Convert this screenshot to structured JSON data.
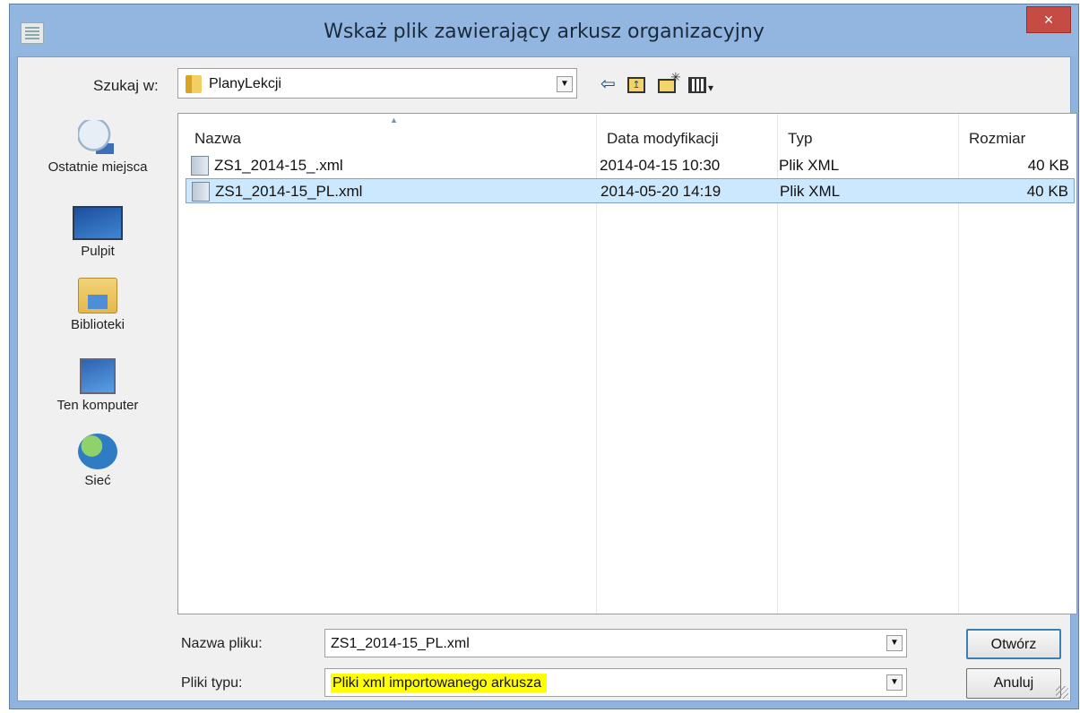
{
  "window": {
    "title": "Wskaż plik zawierający arkusz organizacyjny",
    "close_glyph": "×"
  },
  "lookin": {
    "label": "Szukaj w:",
    "value": "PlanyLekcji"
  },
  "toolbar": {
    "back_glyph": "⇦",
    "up_glyph": "↥",
    "view_arrow": "▾"
  },
  "places": [
    {
      "label": "Ostatnie miejsca",
      "icon": "recent-places-icon"
    },
    {
      "label": "Pulpit",
      "icon": "desktop-icon"
    },
    {
      "label": "Biblioteki",
      "icon": "libraries-icon"
    },
    {
      "label": "Ten komputer",
      "icon": "computer-icon"
    },
    {
      "label": "Sieć",
      "icon": "network-icon"
    }
  ],
  "columns": {
    "name": "Nazwa",
    "date": "Data modyfikacji",
    "type": "Typ",
    "size": "Rozmiar"
  },
  "files": [
    {
      "name": "ZS1_2014-15_.xml",
      "date": "2014-04-15 10:30",
      "type": "Plik XML",
      "size": "40 KB",
      "selected": false
    },
    {
      "name": "ZS1_2014-15_PL.xml",
      "date": "2014-05-20 14:19",
      "type": "Plik XML",
      "size": "40 KB",
      "selected": true
    }
  ],
  "filename": {
    "label": "Nazwa pliku:",
    "value": "ZS1_2014-15_PL.xml"
  },
  "filetype": {
    "label": "Pliki typu:",
    "value": "Pliki xml importowanego arkusza",
    "highlight_color": "#ffff00"
  },
  "buttons": {
    "open": "Otwórz",
    "cancel": "Anuluj"
  },
  "colors": {
    "title_bar": "#92b6df",
    "close_button": "#c64b45",
    "selection": "#cce8ff"
  }
}
